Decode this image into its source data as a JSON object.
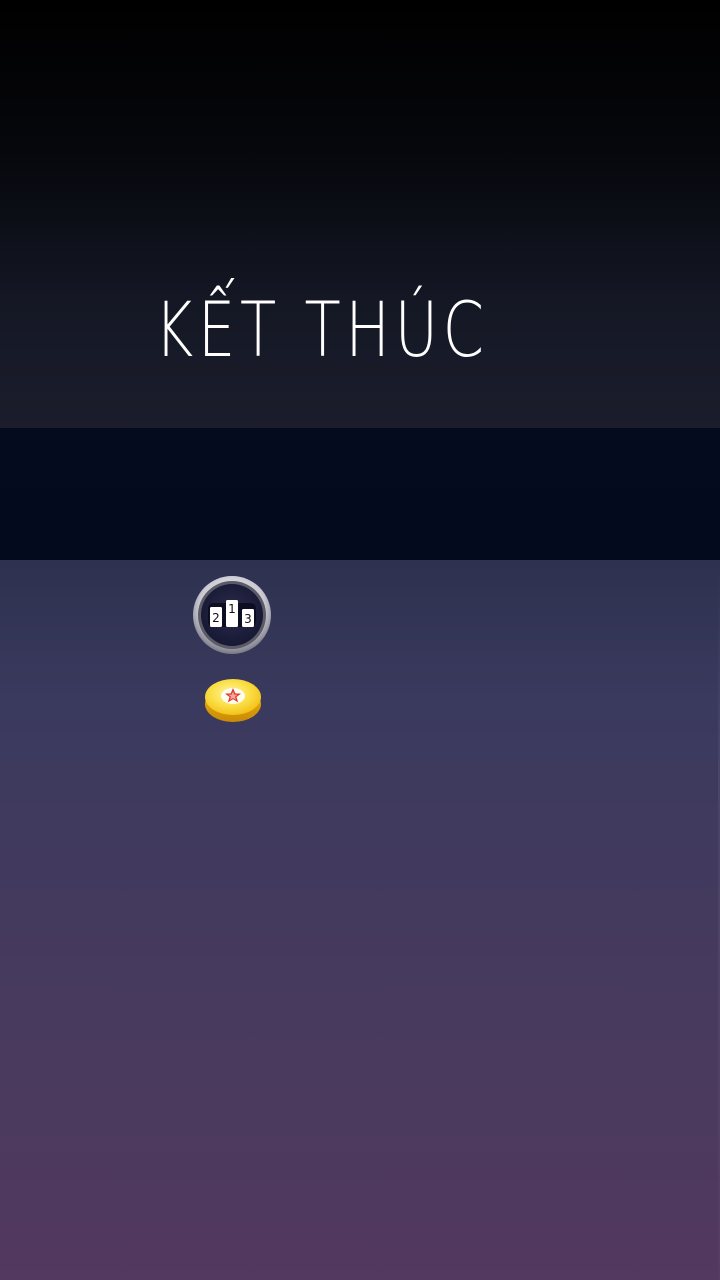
{
  "screen": {
    "title": "KẾT THÚC"
  },
  "leaderboard_button": {
    "icon": "podium-icon",
    "places": [
      "2",
      "1",
      "3"
    ]
  },
  "coin": {
    "icon": "star-coin-icon"
  },
  "colors": {
    "title_text": "#ffffff",
    "band": "#050b1f",
    "bottom_top": "#2e3150",
    "bottom_bottom": "#53385f",
    "coin_gold": "#f7d21c",
    "star_red": "#e23a2a"
  }
}
